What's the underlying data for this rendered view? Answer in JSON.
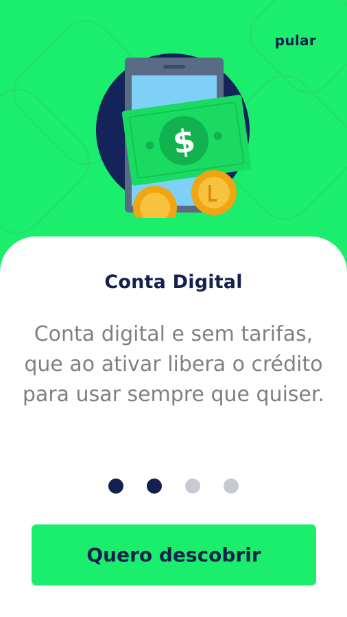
{
  "header": {
    "skip_label": "pular"
  },
  "illustration": {
    "icon": "cash-phone-icon",
    "symbol": "$"
  },
  "slide": {
    "title": "Conta Digital",
    "description": "Conta digital e sem tarifas, que ao ativar libera o crédito para usar sempre que quiser."
  },
  "pagination": {
    "current": 2,
    "total": 4
  },
  "cta": {
    "label": "Quero descobrir"
  },
  "colors": {
    "brand_green": "#1aee6c",
    "navy": "#14204f",
    "text_gray": "#7f7f84",
    "dot_inactive": "#c7cad3"
  }
}
